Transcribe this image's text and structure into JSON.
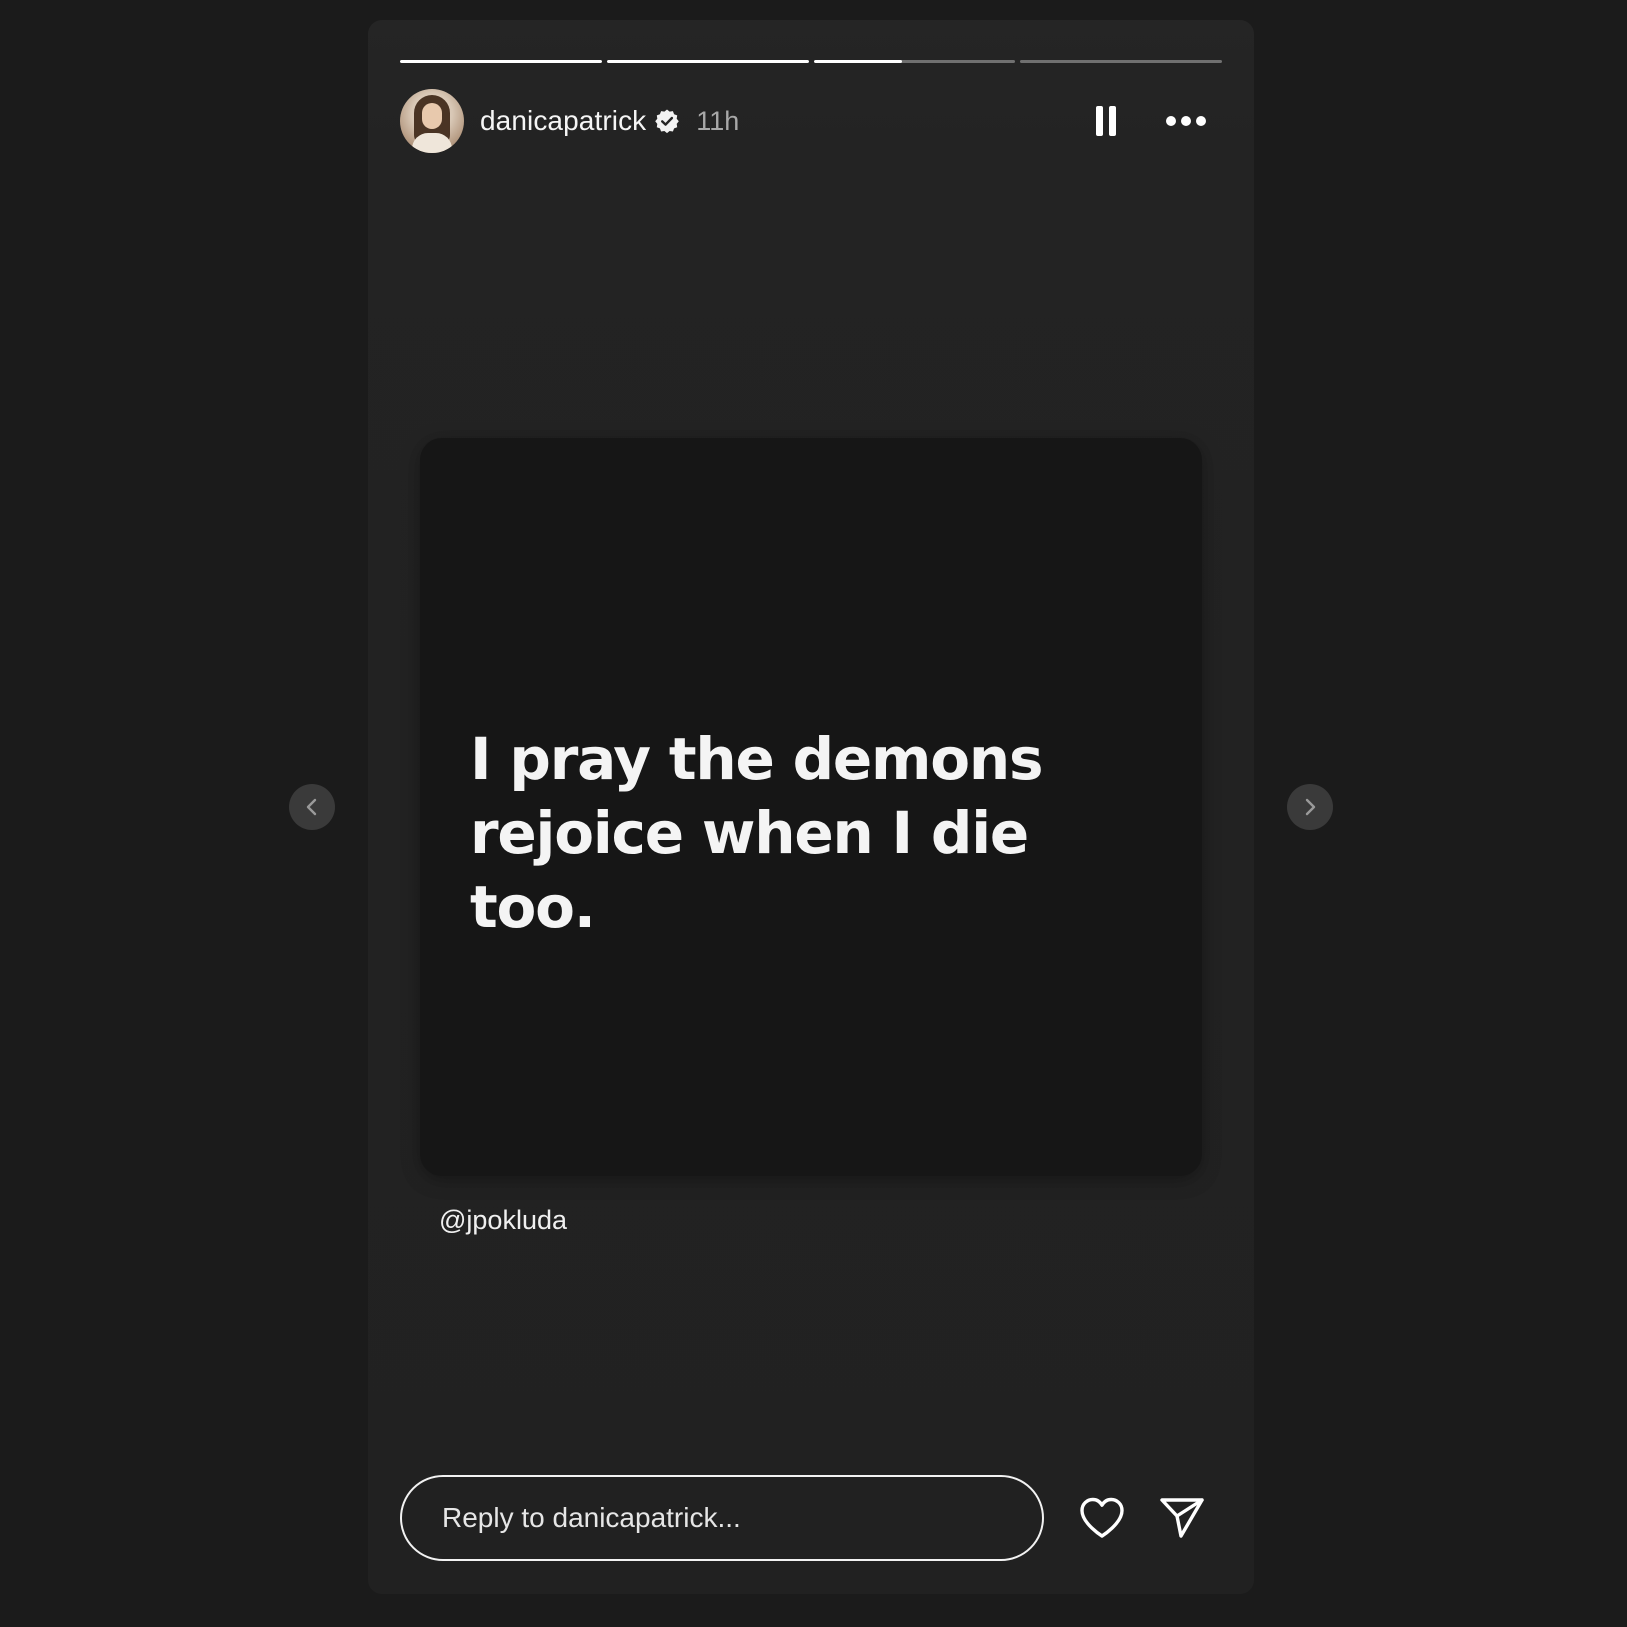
{
  "story": {
    "progress_segments": [
      1.0,
      1.0,
      0.44,
      0.0
    ],
    "author": {
      "username": "danicapatrick",
      "verified": true,
      "time_ago": "11h"
    },
    "content": {
      "quote": "I pray the demons\nrejoice when I die too.",
      "mention": "@jpokluda"
    },
    "reply": {
      "placeholder": "Reply to danicapatrick..."
    }
  },
  "icons": {
    "verified": "verified-badge-icon",
    "pause": "pause-icon",
    "more": "more-options-icon",
    "like": "heart-icon",
    "share": "send-icon",
    "prev": "chevron-left-icon",
    "next": "chevron-right-icon"
  },
  "colors": {
    "background": "#1b1b1b",
    "story_card": "#222222",
    "quote_card": "#161616",
    "text": "#ffffff",
    "muted_text": "#a8a8a8"
  }
}
